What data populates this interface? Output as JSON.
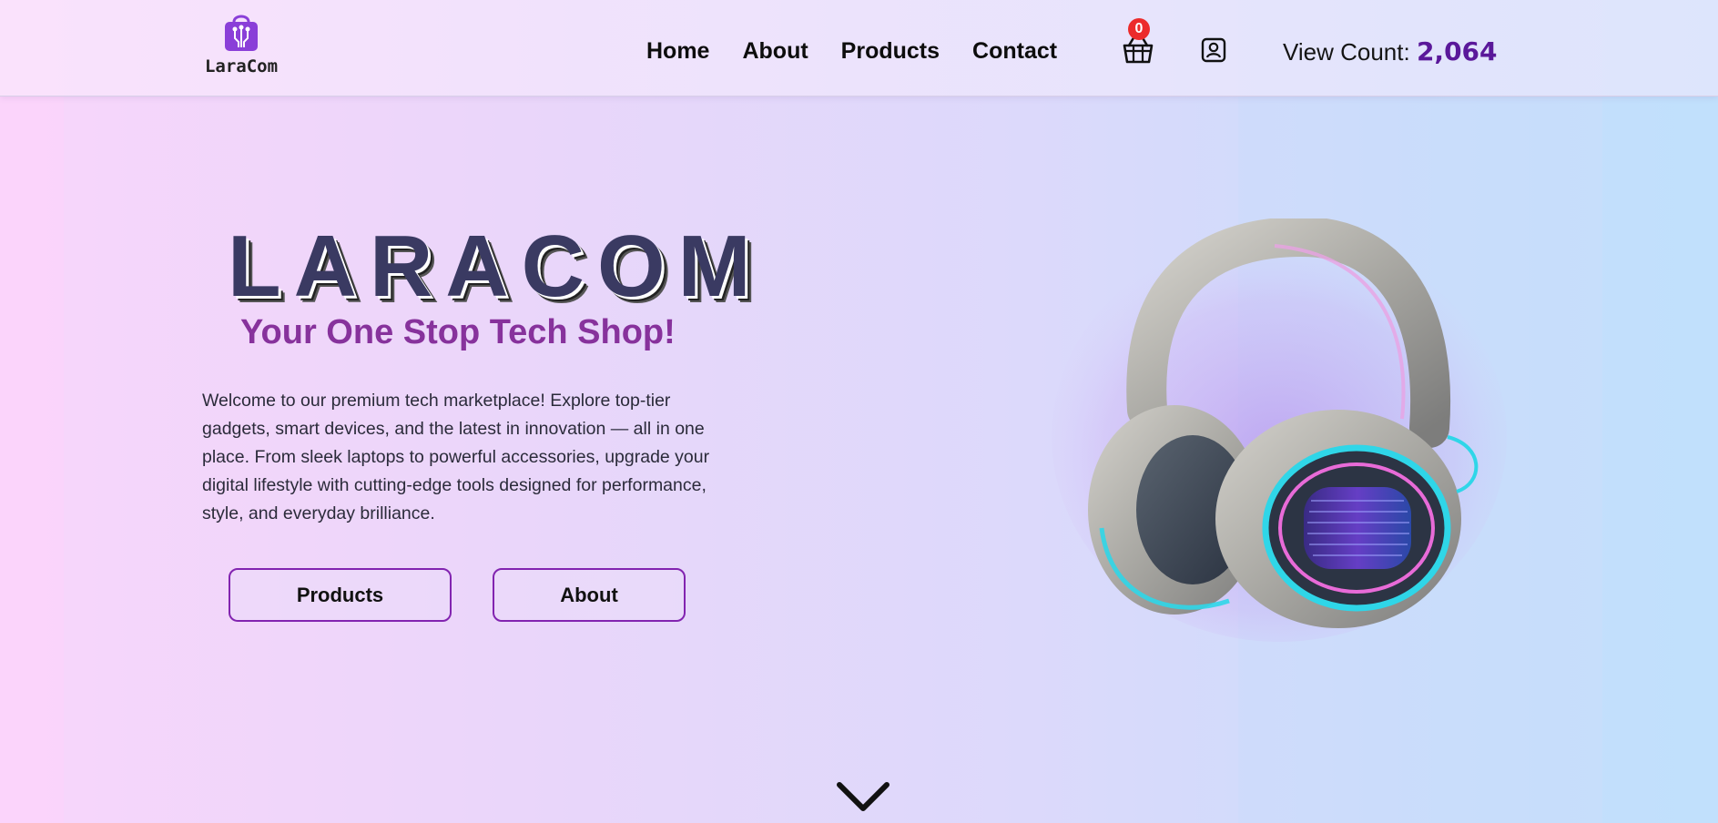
{
  "brand": {
    "name": "LaraCom"
  },
  "nav": {
    "items": [
      {
        "label": "Home"
      },
      {
        "label": "About"
      },
      {
        "label": "Products"
      },
      {
        "label": "Contact"
      }
    ],
    "cart_count": "0",
    "view_count_label": "View Count:",
    "view_count_value": "2,064"
  },
  "hero": {
    "title": "LARACOM",
    "subtitle": "Your One Stop Tech Shop!",
    "description": "Welcome to our premium tech marketplace! Explore top-tier gadgets, smart devices, and the latest in innovation — all in one place. From sleek laptops to powerful accessories, upgrade your digital lifestyle with cutting-edge tools designed for performance, style, and everyday brilliance.",
    "buttons": {
      "products": "Products",
      "about": "About"
    }
  },
  "icons": {
    "logo": "shopping-bag-circuit-icon",
    "cart": "basket-icon",
    "account": "user-profile-icon",
    "scroll": "chevron-down-icon",
    "hero_image": "headphones-image"
  },
  "colors": {
    "accent": "#8224b0",
    "subtitle": "#87329c",
    "view_count": "#5a189a",
    "title": "#3a3a62",
    "badge": "#ec2b2b",
    "headphone_glow_cyan": "#29d6e8",
    "headphone_glow_pink": "#e86bd8"
  }
}
